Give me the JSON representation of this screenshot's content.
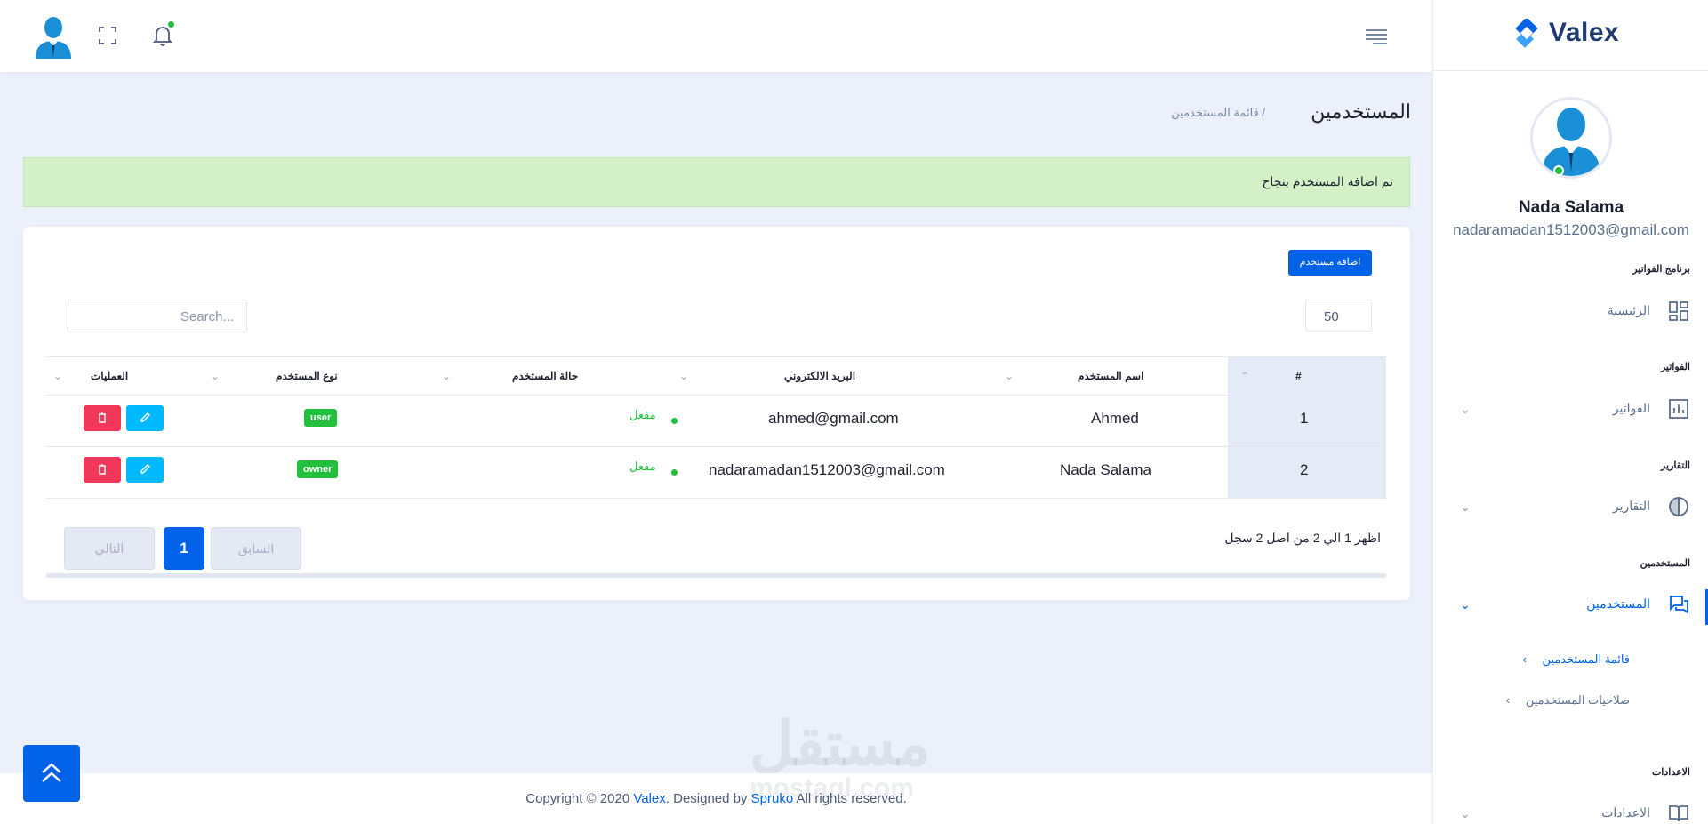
{
  "brand": {
    "name": "Valex"
  },
  "header": {
    "notification_indicator": "green"
  },
  "sidebar": {
    "user_name": "Nada Salama",
    "user_email": "nadaramadan1512003@gmail.com",
    "sections": [
      {
        "category": "برنامج الفواتير",
        "item": "الرئيسية",
        "icon": "dashboard-icon"
      },
      {
        "category": "الفواتير",
        "item": "الفواتير",
        "icon": "bar-chart-icon"
      },
      {
        "category": "التقارير",
        "item": "التقارير",
        "icon": "pie-chart-icon"
      },
      {
        "category": "المستخدمين",
        "item": "المستخدمين",
        "icon": "chat-icon"
      },
      {
        "category": "الاعدادات",
        "item": "الاعدادات",
        "icon": "book-icon"
      }
    ],
    "submenu": [
      "قائمة المستخدمين",
      "صلاحيات المستخدمين"
    ]
  },
  "breadcrumb": {
    "title": "المستخدمين",
    "sub": "/ قائمة المستخدمين"
  },
  "alert": {
    "text": "تم اضافة المستخدم بنجاح"
  },
  "toolbar": {
    "add_user_label": "اضافة مستخدم",
    "page_length": "50",
    "search_placeholder": "Search..."
  },
  "table": {
    "columns": [
      "#",
      "اسم المستخدم",
      "البريد الالكتروني",
      "حالة المستخدم",
      "نوع المستخدم",
      "العمليات"
    ],
    "rows": [
      {
        "num": "1",
        "name": "Ahmed",
        "email": "ahmed@gmail.com",
        "status": "مفعل",
        "type": "user"
      },
      {
        "num": "2",
        "name": "Nada Salama",
        "email": "nadaramadan1512003@gmail.com",
        "status": "مفعل",
        "type": "owner"
      }
    ]
  },
  "pagination": {
    "info": "اظهر 1 الي 2 من اصل 2 سجل",
    "prev": "السابق",
    "current": "1",
    "next": "التالي"
  },
  "footer": {
    "prefix": "Copyright © 2020 ",
    "brand": "Valex",
    "middle": ". Designed by ",
    "designer": "Spruko",
    "suffix": " All rights reserved."
  },
  "watermark": {
    "arabic": "مستقل",
    "latin": "mostaql.com"
  },
  "colors": {
    "primary": "#0162e8",
    "success": "#22c03c",
    "danger": "#f1385a",
    "info": "#00b9ff"
  }
}
